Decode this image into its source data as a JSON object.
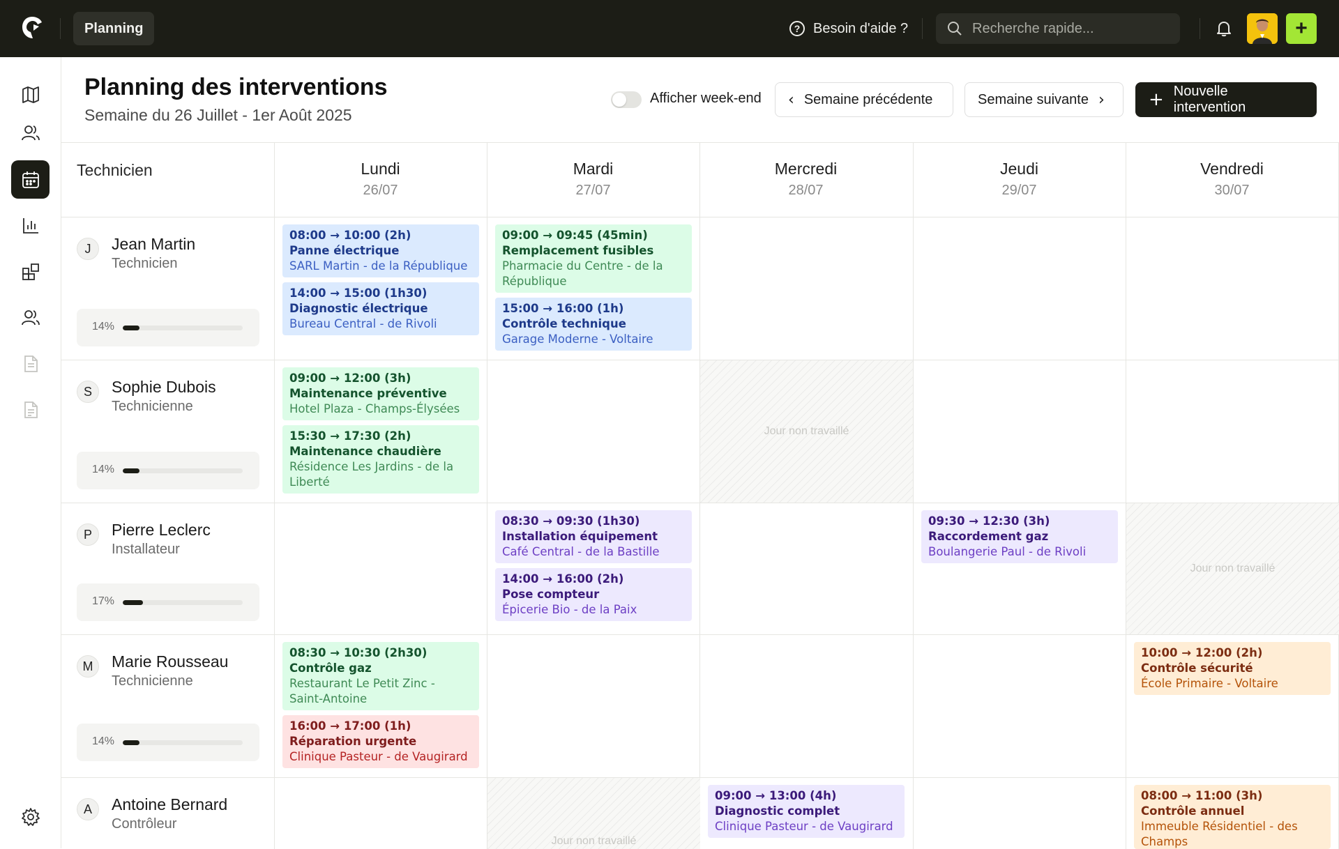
{
  "topbar": {
    "active_tab": "Planning",
    "help_label": "Besoin d'aide ?",
    "search_placeholder": "Recherche rapide..."
  },
  "header": {
    "title": "Planning des interventions",
    "subtitle": "Semaine du 26 Juillet - 1er Août 2025",
    "weekend_toggle_label": "Afficher week-end",
    "weekend_toggle_on": false,
    "prev_week": "Semaine précédente",
    "next_week": "Semaine suivante",
    "new_intervention": "Nouvelle intervention"
  },
  "grid": {
    "technician_header": "Technicien",
    "days": [
      {
        "name": "Lundi",
        "date": "26/07"
      },
      {
        "name": "Mardi",
        "date": "27/07"
      },
      {
        "name": "Mercredi",
        "date": "28/07"
      },
      {
        "name": "Jeudi",
        "date": "29/07"
      },
      {
        "name": "Vendredi",
        "date": "30/07"
      }
    ],
    "day_off_label": "Jour non travaillé",
    "technicians": [
      {
        "initial": "J",
        "name": "Jean Martin",
        "role": "Technicien",
        "load_label": "14%",
        "load": 14
      },
      {
        "initial": "S",
        "name": "Sophie Dubois",
        "role": "Technicienne",
        "load_label": "14%",
        "load": 14
      },
      {
        "initial": "P",
        "name": "Pierre Leclerc",
        "role": "Installateur",
        "load_label": "17%",
        "load": 17
      },
      {
        "initial": "M",
        "name": "Marie Rousseau",
        "role": "Technicienne",
        "load_label": "14%",
        "load": 14
      },
      {
        "initial": "A",
        "name": "Antoine Bernard",
        "role": "Contrôleur"
      }
    ],
    "events": [
      {
        "time": "08:00 → 10:00 (2h)",
        "title": "Panne électrique",
        "client": "SARL Martin - de la République",
        "color": "blue"
      },
      {
        "time": "14:00 → 15:00 (1h30)",
        "title": "Diagnostic électrique",
        "client": "Bureau Central - de Rivoli",
        "color": "blue"
      },
      {
        "time": "09:00 → 09:45 (45min)",
        "title": "Remplacement fusibles",
        "client": "Pharmacie du Centre - de la République",
        "color": "green"
      },
      {
        "time": "15:00 → 16:00 (1h)",
        "title": "Contrôle technique",
        "client": "Garage Moderne - Voltaire",
        "color": "blue"
      },
      {
        "time": "09:00 → 12:00 (3h)",
        "title": "Maintenance préventive",
        "client": "Hotel Plaza - Champs-Élysées",
        "color": "green"
      },
      {
        "time": "15:30 → 17:30 (2h)",
        "title": "Maintenance chaudière",
        "client": "Résidence Les Jardins - de la Liberté",
        "color": "green"
      },
      {
        "time": "08:30 → 09:30 (1h30)",
        "title": "Installation équipement",
        "client": "Café Central - de la Bastille",
        "color": "purple"
      },
      {
        "time": "14:00 → 16:00 (2h)",
        "title": "Pose compteur",
        "client": "Épicerie Bio - de la Paix",
        "color": "purple"
      },
      {
        "time": "09:30 → 12:30 (3h)",
        "title": "Raccordement gaz",
        "client": "Boulangerie Paul - de Rivoli",
        "color": "purple"
      },
      {
        "time": "08:30 → 10:30 (2h30)",
        "title": "Contrôle gaz",
        "client": "Restaurant Le Petit Zinc - Saint-Antoine",
        "color": "green"
      },
      {
        "time": "16:00 → 17:00 (1h)",
        "title": "Réparation urgente",
        "client": "Clinique Pasteur - de Vaugirard",
        "color": "red"
      },
      {
        "time": "10:00 → 12:00 (2h)",
        "title": "Contrôle sécurité",
        "client": "École Primaire - Voltaire",
        "color": "orange"
      },
      {
        "time": "09:00 → 13:00 (4h)",
        "title": "Diagnostic complet",
        "client": "Clinique Pasteur - de Vaugirard",
        "color": "purple"
      },
      {
        "time": "08:00 → 11:00 (3h)",
        "title": "Contrôle annuel",
        "client": "Immeuble Résidentiel - des Champs",
        "color": "orange"
      }
    ]
  },
  "sidebar": {
    "items": [
      "map-icon",
      "users-icon",
      "calendar-icon",
      "chart-icon",
      "modules-icon",
      "team-icon",
      "document-icon",
      "invoice-icon",
      "settings-icon"
    ]
  }
}
